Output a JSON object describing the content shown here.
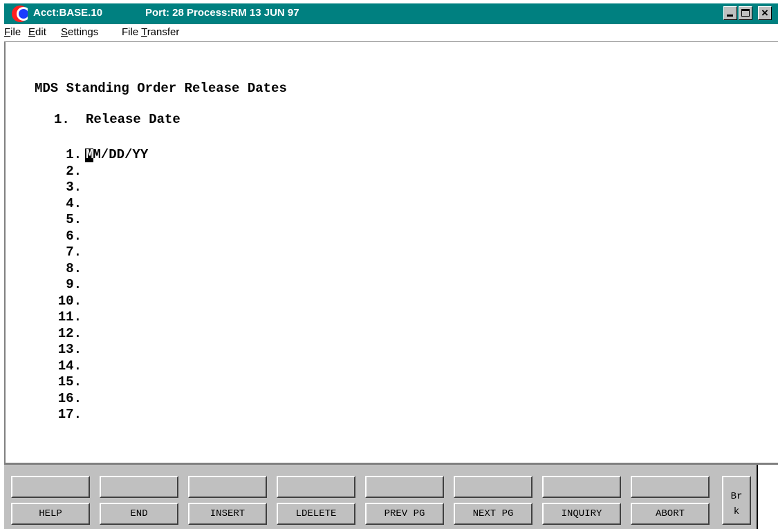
{
  "window": {
    "title_account": "Acct:BASE.10",
    "title_port": "Port: 28 Process:RM 13 JUN 97",
    "titlebar_color": "#008080",
    "icon": "app-crescent-icon"
  },
  "menu": {
    "file": "ile",
    "file_key": "F",
    "edit": "dit",
    "edit_key": "E",
    "settings": "ettings",
    "settings_key": "S",
    "transfer_prefix": "File ",
    "transfer_key": "T",
    "transfer": "ransfer"
  },
  "screen": {
    "title": "MDS Standing Order Release Dates",
    "column_number": "1.",
    "column_label": "Release Date",
    "field_value": " M/DD/YY",
    "field_first_char": "M",
    "lines": [
      "1.",
      "2.",
      "3.",
      "4.",
      "5.",
      "6.",
      "7.",
      "8.",
      "9.",
      "10.",
      "11.",
      "12.",
      "13.",
      "14.",
      "15.",
      "16.",
      "17."
    ]
  },
  "function_keys": {
    "top": [
      "",
      "",
      "",
      "",
      "",
      "",
      "",
      ""
    ],
    "bottom": [
      "HELP",
      "END",
      "INSERT",
      "LDELETE",
      "PREV PG",
      "NEXT PG",
      "INQUIRY",
      "ABORT"
    ],
    "break_line1": "Br",
    "break_line2": "k"
  }
}
